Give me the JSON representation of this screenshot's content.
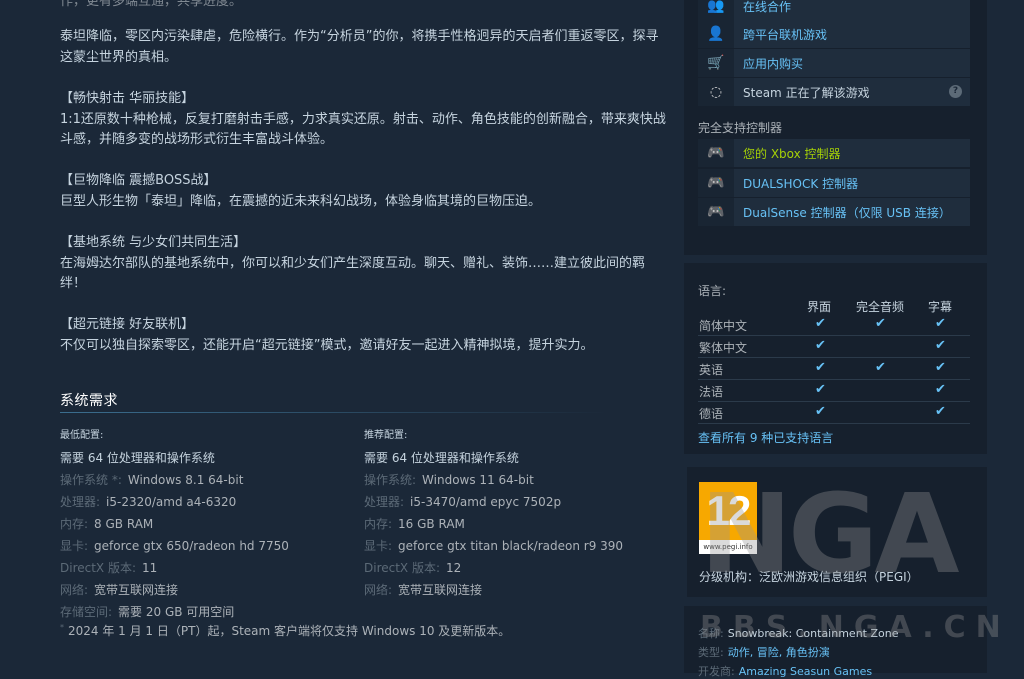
{
  "description": {
    "cut_line": "作，更有多端互通，共享进度。",
    "p1": "泰坦降临，零区内污染肆虐，危险横行。作为“分析员”的你，将携手性格迥异的天启者们重返零区，探寻这蒙尘世界的真相。",
    "p2_title": "【畅快射击 华丽技能】",
    "p2_body": "1:1还原数十种枪械，反复打磨射击手感，力求真实还原。射击、动作、角色技能的创新融合，带来爽快战斗感，并随多变的战场形式衍生丰富战斗体验。",
    "p3_title": "【巨物降临 震撼BOSS战】",
    "p3_body": "巨型人形生物「泰坦」降临，在震撼的近未来科幻战场，体验身临其境的巨物压迫。",
    "p4_title": "【基地系统 与少女们共同生活】",
    "p4_body": "在海姆达尔部队的基地系统中，你可以和少女们产生深度互动。聊天、赠礼、装饰……建立彼此间的羁绊！",
    "p5_title": "【超元链接 好友联机】",
    "p5_body": "不仅可以独自探索零区，还能开启“超元链接”模式，邀请好友一起进入精神拟境，提升实力。"
  },
  "sysreq": {
    "title": "系统需求",
    "min": {
      "head": "最低配置:",
      "first": "需要 64 位处理器和操作系统",
      "rows": [
        {
          "k": "操作系统 *:",
          "v": "Windows 8.1 64-bit"
        },
        {
          "k": "处理器:",
          "v": "i5-2320/amd a4-6320"
        },
        {
          "k": "内存:",
          "v": "8 GB RAM"
        },
        {
          "k": "显卡:",
          "v": "geforce gtx 650/radeon hd 7750"
        },
        {
          "k": "DirectX 版本:",
          "v": "11"
        },
        {
          "k": "网络:",
          "v": "宽带互联网连接"
        },
        {
          "k": "存储空间:",
          "v": "需要 20 GB 可用空间"
        }
      ]
    },
    "rec": {
      "head": "推荐配置:",
      "first": "需要 64 位处理器和操作系统",
      "rows": [
        {
          "k": "操作系统:",
          "v": "Windows 11 64-bit"
        },
        {
          "k": "处理器:",
          "v": "i5-3470/amd epyc 7502p"
        },
        {
          "k": "内存:",
          "v": "16 GB RAM"
        },
        {
          "k": "显卡:",
          "v": "geforce gtx titan black/radeon r9 390"
        },
        {
          "k": "DirectX 版本:",
          "v": "12"
        },
        {
          "k": "网络:",
          "v": "宽带互联网连接"
        }
      ]
    },
    "notice_mark": "*",
    "notice": "2024 年 1 月 1 日（PT）起，Steam 客户端将仅支持 Windows 10 及更新版本。"
  },
  "features": {
    "items": [
      {
        "label": "在线合作",
        "icon": "users-icon",
        "glyph": "👥"
      },
      {
        "label": "跨平台联机游戏",
        "icon": "crossplay-icon",
        "glyph": "👤"
      },
      {
        "label": "应用内购买",
        "icon": "cart-icon",
        "glyph": "🛒"
      },
      {
        "label": "Steam 正在了解该游戏",
        "icon": "loading-icon",
        "glyph": "◌",
        "help": "?"
      }
    ],
    "controller_title": "完全支持控制器",
    "controllers": [
      {
        "label": "您的 Xbox 控制器",
        "icon": "gamepad-icon",
        "glyph": "🎮"
      },
      {
        "label": "DUALSHOCK 控制器",
        "icon": "gamepad-icon",
        "glyph": "🎮"
      },
      {
        "label": "DualSense 控制器（仅限 USB 连接）",
        "icon": "gamepad-icon",
        "glyph": "🎮"
      }
    ]
  },
  "languages": {
    "title": "语言:",
    "headers": [
      "界面",
      "完全音频",
      "字幕"
    ],
    "check": "✔",
    "rows": [
      {
        "name": "简体中文",
        "ui": true,
        "audio": true,
        "subs": true
      },
      {
        "name": "繁体中文",
        "ui": true,
        "audio": false,
        "subs": true
      },
      {
        "name": "英语",
        "ui": true,
        "audio": true,
        "subs": true
      },
      {
        "name": "法语",
        "ui": true,
        "audio": false,
        "subs": true
      },
      {
        "name": "德语",
        "ui": true,
        "audio": false,
        "subs": true
      }
    ],
    "link": "查看所有 9 种已支持语言"
  },
  "rating": {
    "pegi_number": "12",
    "pegi_url": "www.pegi.info",
    "label": "分级机构：泛欧洲游戏信息组织（PEGI）"
  },
  "watermark": {
    "big": "NGA",
    "small": "BBS.NGA.CN"
  },
  "info": {
    "name_key": "名称:",
    "name_val": "Snowbreak: Containment Zone",
    "genre_key": "类型:",
    "genres": "动作, 冒险, 角色扮演",
    "dev_key": "开发商:",
    "dev_val": "Amazing Seasun Games"
  },
  "colors": {
    "background": "#1b2838",
    "link": "#67c1f5",
    "xbox_green": "#a4d007",
    "pegi_orange": "#f7a800"
  }
}
